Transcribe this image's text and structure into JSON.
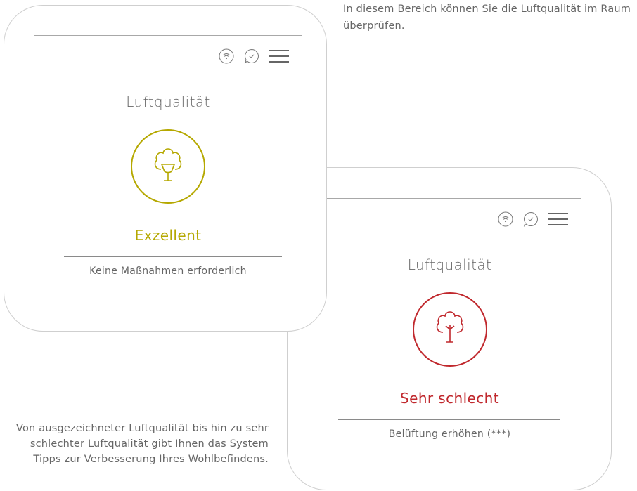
{
  "captions": {
    "top": "In diesem Bereich können Sie die Luftqualität im Raum überprüfen.",
    "bottom": "Von ausgezeichneter Luftqualität bis hin zu sehr schlechter Luftqualität gibt Ihnen das System Tipps zur Verbesserung Ihres Wohlbefindens."
  },
  "devices": [
    {
      "title": "Luftqualität",
      "status": "Exzellent",
      "status_color": "#b5a800",
      "advice": "Keine Maßnahmen erforderlich",
      "icons": [
        "wifi-icon",
        "chat-check-icon",
        "menu-icon",
        "tree-icon"
      ]
    },
    {
      "title": "Luftqualität",
      "status": "Sehr schlecht",
      "status_color": "#c0282d",
      "advice": "Belüftung erhöhen (***)",
      "icons": [
        "wifi-icon",
        "chat-check-icon",
        "menu-icon",
        "tree-icon"
      ]
    }
  ]
}
